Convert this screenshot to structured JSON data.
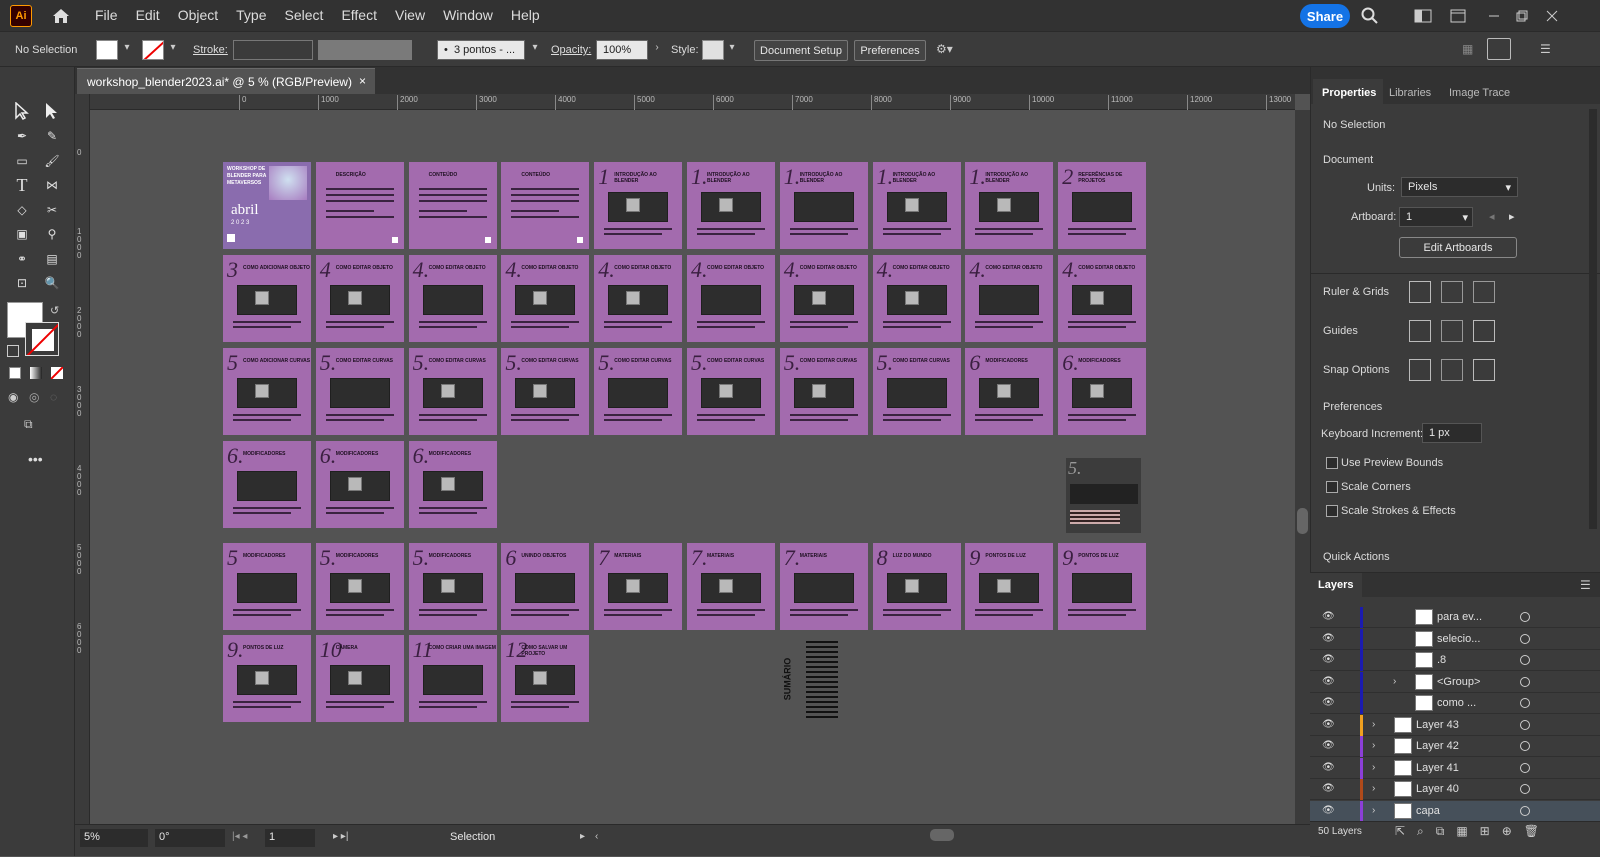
{
  "app": {
    "logo_text": "Ai",
    "menus": [
      "File",
      "Edit",
      "Object",
      "Type",
      "Select",
      "Effect",
      "View",
      "Window",
      "Help"
    ],
    "share_label": "Share"
  },
  "control": {
    "selection": "No Selection",
    "stroke_label": "Stroke:",
    "brush_value": "3 pontos - ...",
    "opacity_label": "Opacity:",
    "opacity_value": "100%",
    "style_label": "Style:",
    "doc_setup": "Document Setup",
    "preferences": "Preferences"
  },
  "document": {
    "tab_title": "workshop_blender2023.ai* @ 5 % (RGB/Preview)",
    "close": "×"
  },
  "ruler": {
    "h_ticks": [
      "0",
      "1000",
      "2000",
      "3000",
      "4000",
      "5000",
      "6000",
      "7000",
      "8000",
      "9000",
      "10000",
      "11000",
      "12000",
      "13000"
    ],
    "v_ticks": [
      "0",
      "1000",
      "2000",
      "3000",
      "4000",
      "5000",
      "6000"
    ]
  },
  "artboards": [
    {
      "num": "",
      "title": "WORKSHOP DE BLENDER PARA METAVERSOS"
    },
    {
      "num": "",
      "title": "DESCRIÇÃO"
    },
    {
      "num": "",
      "title": "CONTEÚDO"
    },
    {
      "num": "",
      "title": "CONTEÚDO"
    },
    {
      "num": "1",
      "title": "INTRODUÇÃO AO BLENDER"
    },
    {
      "num": "1.",
      "title": "INTRODUÇÃO AO BLENDER"
    },
    {
      "num": "1.",
      "title": "INTRODUÇÃO AO BLENDER"
    },
    {
      "num": "1.",
      "title": "INTRODUÇÃO AO BLENDER"
    },
    {
      "num": "1.",
      "title": "INTRODUÇÃO AO BLENDER"
    },
    {
      "num": "2",
      "title": "REFERÊNCIAS DE PROJETOS"
    },
    {
      "num": "3",
      "title": "COMO ADICIONAR OBJETO"
    },
    {
      "num": "4",
      "title": "COMO EDITAR OBJETO"
    },
    {
      "num": "4.",
      "title": "COMO EDITAR OBJETO"
    },
    {
      "num": "4.",
      "title": "COMO EDITAR OBJETO"
    },
    {
      "num": "4.",
      "title": "COMO EDITAR OBJETO"
    },
    {
      "num": "4.",
      "title": "COMO EDITAR OBJETO"
    },
    {
      "num": "4.",
      "title": "COMO EDITAR OBJETO"
    },
    {
      "num": "4.",
      "title": "COMO EDITAR OBJETO"
    },
    {
      "num": "4.",
      "title": "COMO EDITAR OBJETO"
    },
    {
      "num": "4.",
      "title": "COMO EDITAR OBJETO"
    },
    {
      "num": "5",
      "title": "COMO ADICIONAR CURVAS"
    },
    {
      "num": "5.",
      "title": "COMO EDITAR CURVAS"
    },
    {
      "num": "5.",
      "title": "COMO EDITAR CURVAS"
    },
    {
      "num": "5.",
      "title": "COMO EDITAR CURVAS"
    },
    {
      "num": "5.",
      "title": "COMO EDITAR CURVAS"
    },
    {
      "num": "5.",
      "title": "COMO EDITAR CURVAS"
    },
    {
      "num": "5.",
      "title": "COMO EDITAR CURVAS"
    },
    {
      "num": "5.",
      "title": "COMO EDITAR CURVAS"
    },
    {
      "num": "6",
      "title": "MODIFICADORES"
    },
    {
      "num": "6.",
      "title": "MODIFICADORES"
    },
    {
      "num": "6.",
      "title": "MODIFICADORES"
    },
    {
      "num": "6.",
      "title": "MODIFICADORES"
    },
    {
      "num": "6.",
      "title": "MODIFICADORES"
    },
    {
      "num": "5",
      "title": "MODIFICADORES"
    },
    {
      "num": "5.",
      "title": "MODIFICADORES"
    },
    {
      "num": "5.",
      "title": "MODIFICADORES"
    },
    {
      "num": "6",
      "title": "UNINDO OBJETOS"
    },
    {
      "num": "7",
      "title": "MATERIAIS"
    },
    {
      "num": "7.",
      "title": "MATERIAIS"
    },
    {
      "num": "7.",
      "title": "MATERIAIS"
    },
    {
      "num": "8",
      "title": "LUZ DO MUNDO"
    },
    {
      "num": "9",
      "title": "PONTOS DE LUZ"
    },
    {
      "num": "9.",
      "title": "PONTOS DE LUZ"
    },
    {
      "num": "9.",
      "title": "PONTOS DE LUZ"
    },
    {
      "num": "10",
      "title": "CÂMERA"
    },
    {
      "num": "11",
      "title": "COMO CRIAR UMA IMAGEM"
    },
    {
      "num": "12",
      "title": "COMO SALVAR UM PROJETO"
    }
  ],
  "cover": {
    "year_word": "abril",
    "year_num": "2 0 2 3"
  },
  "summary_label": "SUMÁRIO",
  "floating_board": {
    "num": "5."
  },
  "status": {
    "zoom": "5%",
    "rotation": "0°",
    "artboard": "1",
    "tool": "Selection"
  },
  "panel": {
    "tabs": [
      "Properties",
      "Libraries",
      "Image Trace"
    ],
    "no_selection": "No Selection",
    "document_heading": "Document",
    "units_label": "Units:",
    "units_value": "Pixels",
    "artboard_label": "Artboard:",
    "artboard_value": "1",
    "edit_artboards": "Edit Artboards",
    "ruler_grids": "Ruler & Grids",
    "guides": "Guides",
    "snap_options": "Snap Options",
    "preferences": "Preferences",
    "kb_label": "Keyboard Increment:",
    "kb_value": "1 px",
    "use_preview_bounds": "Use Preview Bounds",
    "scale_corners": "Scale Corners",
    "scale_strokes": "Scale Strokes & Effects",
    "quick_actions": "Quick Actions"
  },
  "layers": {
    "title": "Layers",
    "rows": [
      {
        "name": "para ev...",
        "color": "#1b1bb0",
        "indent": true,
        "expand": false
      },
      {
        "name": "selecio...",
        "color": "#1b1bb0",
        "indent": true,
        "expand": false
      },
      {
        "name": ".8",
        "color": "#1b1bb0",
        "indent": true,
        "expand": false
      },
      {
        "name": "<Group>",
        "color": "#1b1bb0",
        "indent": true,
        "expand": true
      },
      {
        "name": "como ...",
        "color": "#1b1bb0",
        "indent": true,
        "expand": false
      },
      {
        "name": "Layer 43",
        "color": "#f0a020",
        "indent": false,
        "expand": true
      },
      {
        "name": "Layer 42",
        "color": "#8c3fd8",
        "indent": false,
        "expand": true
      },
      {
        "name": "Layer 41",
        "color": "#8c3fd8",
        "indent": false,
        "expand": true
      },
      {
        "name": "Layer 40",
        "color": "#b04a1a",
        "indent": false,
        "expand": true
      },
      {
        "name": "capa",
        "color": "#8c3fd8",
        "indent": false,
        "expand": true
      }
    ],
    "count": "50 Layers"
  }
}
